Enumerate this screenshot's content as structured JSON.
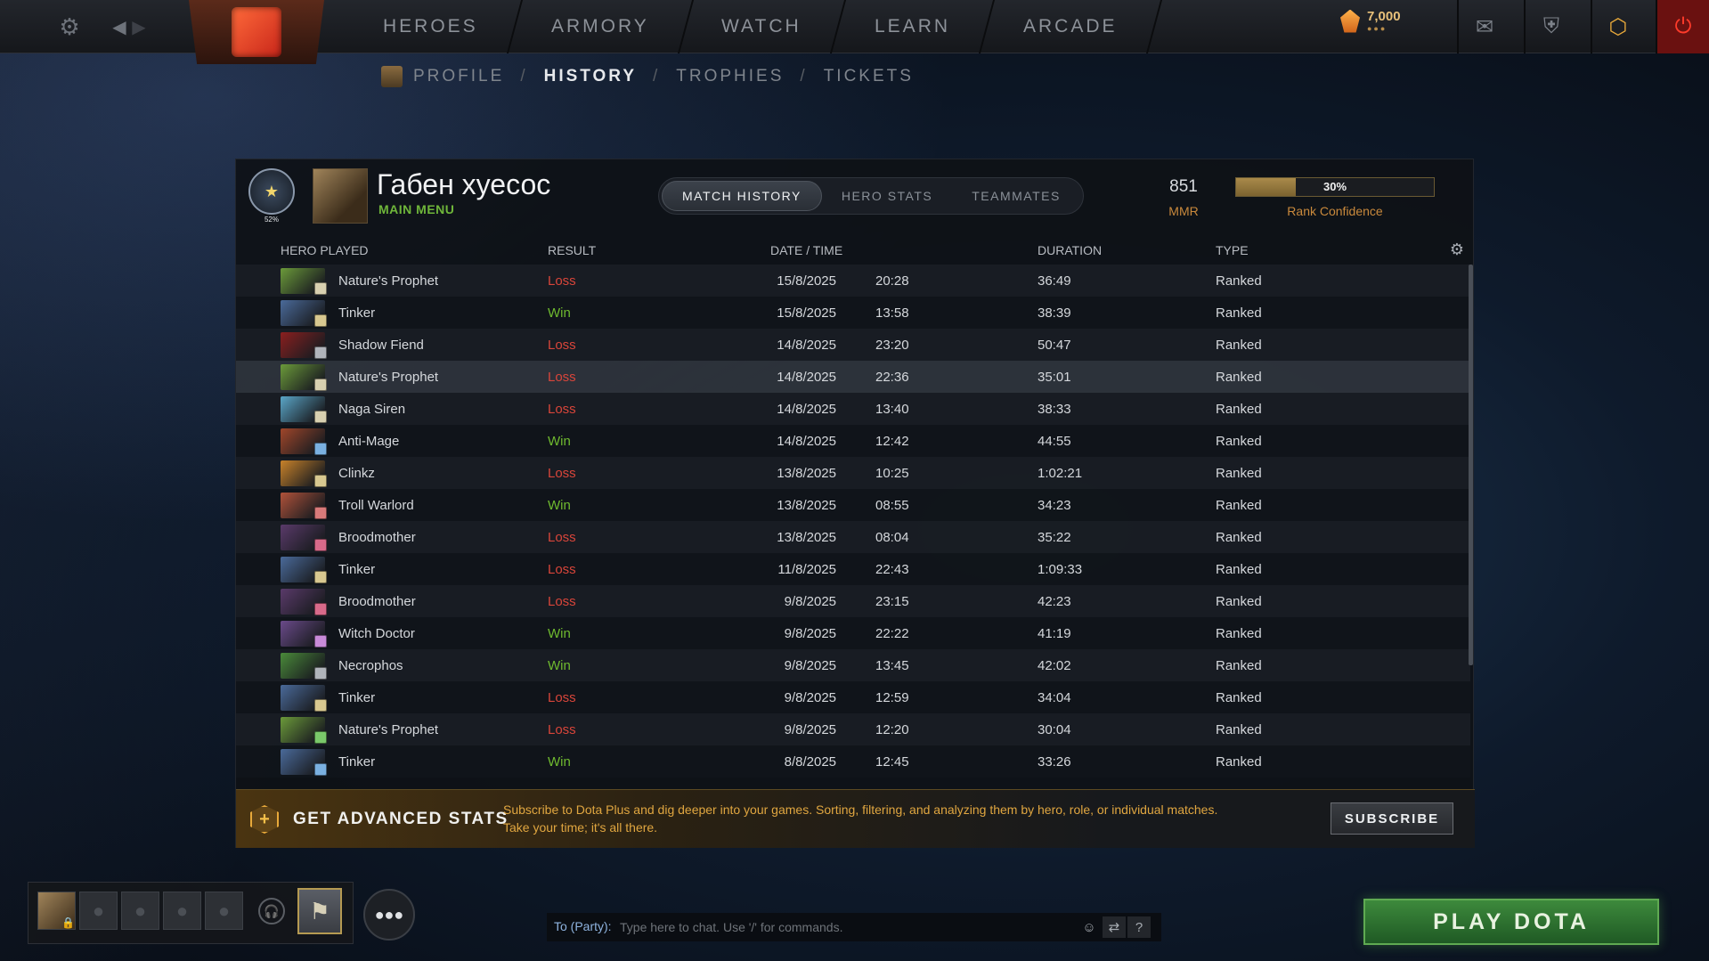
{
  "topbar": {
    "nav": [
      "HEROES",
      "ARMORY",
      "WATCH",
      "LEARN",
      "ARCADE"
    ],
    "shards": "7,000",
    "shard_dots": "●●●"
  },
  "subnav": {
    "items": [
      "PROFILE",
      "HISTORY",
      "TROPHIES",
      "TICKETS"
    ],
    "separator": "/"
  },
  "header": {
    "medal_pct": "52%",
    "player_name": "Габен хуесос",
    "player_status": "MAIN MENU",
    "tabs": [
      "MATCH HISTORY",
      "HERO STATS",
      "TEAMMATES"
    ],
    "mmr_value": "851",
    "mmr_label": "MMR",
    "rank_confidence_value": 30,
    "rank_confidence_text": "30%",
    "rank_confidence_label": "Rank Confidence"
  },
  "table": {
    "columns": [
      "HERO PLAYED",
      "RESULT",
      "DATE / TIME",
      "DURATION",
      "TYPE"
    ],
    "rows": [
      {
        "hero": "Nature's Prophet",
        "result": "Loss",
        "date": "15/8/2025",
        "time": "20:28",
        "duration": "36:49",
        "type": "Ranked",
        "color": "#6b9a3a",
        "badge": "#d8d0b0"
      },
      {
        "hero": "Tinker",
        "result": "Win",
        "date": "15/8/2025",
        "time": "13:58",
        "duration": "38:39",
        "type": "Ranked",
        "color": "#4a6a9a",
        "badge": "#d8c890"
      },
      {
        "hero": "Shadow Fiend",
        "result": "Loss",
        "date": "14/8/2025",
        "time": "23:20",
        "duration": "50:47",
        "type": "Ranked",
        "color": "#8a1f1f",
        "badge": "#b0b4bb"
      },
      {
        "hero": "Nature's Prophet",
        "result": "Loss",
        "date": "14/8/2025",
        "time": "22:36",
        "duration": "35:01",
        "type": "Ranked",
        "color": "#6b9a3a",
        "badge": "#d8d0b0"
      },
      {
        "hero": "Naga Siren",
        "result": "Loss",
        "date": "14/8/2025",
        "time": "13:40",
        "duration": "38:33",
        "type": "Ranked",
        "color": "#5aa6c8",
        "badge": "#d8d0b0"
      },
      {
        "hero": "Anti-Mage",
        "result": "Win",
        "date": "14/8/2025",
        "time": "12:42",
        "duration": "44:55",
        "type": "Ranked",
        "color": "#a0462a",
        "badge": "#7ab0e0"
      },
      {
        "hero": "Clinkz",
        "result": "Loss",
        "date": "13/8/2025",
        "time": "10:25",
        "duration": "1:02:21",
        "type": "Ranked",
        "color": "#c8822a",
        "badge": "#d8c890"
      },
      {
        "hero": "Troll Warlord",
        "result": "Win",
        "date": "13/8/2025",
        "time": "08:55",
        "duration": "34:23",
        "type": "Ranked",
        "color": "#b0523a",
        "badge": "#d87a7a"
      },
      {
        "hero": "Broodmother",
        "result": "Loss",
        "date": "13/8/2025",
        "time": "08:04",
        "duration": "35:22",
        "type": "Ranked",
        "color": "#5a3a6a",
        "badge": "#d86a8a"
      },
      {
        "hero": "Tinker",
        "result": "Loss",
        "date": "11/8/2025",
        "time": "22:43",
        "duration": "1:09:33",
        "type": "Ranked",
        "color": "#4a6a9a",
        "badge": "#d8c890"
      },
      {
        "hero": "Broodmother",
        "result": "Loss",
        "date": "9/8/2025",
        "time": "23:15",
        "duration": "42:23",
        "type": "Ranked",
        "color": "#5a3a6a",
        "badge": "#d86a8a"
      },
      {
        "hero": "Witch Doctor",
        "result": "Win",
        "date": "9/8/2025",
        "time": "22:22",
        "duration": "41:19",
        "type": "Ranked",
        "color": "#6a4a8a",
        "badge": "#c88ad8"
      },
      {
        "hero": "Necrophos",
        "result": "Win",
        "date": "9/8/2025",
        "time": "13:45",
        "duration": "42:02",
        "type": "Ranked",
        "color": "#4a8a3a",
        "badge": "#b0b4bb"
      },
      {
        "hero": "Tinker",
        "result": "Loss",
        "date": "9/8/2025",
        "time": "12:59",
        "duration": "34:04",
        "type": "Ranked",
        "color": "#4a6a9a",
        "badge": "#d8c890"
      },
      {
        "hero": "Nature's Prophet",
        "result": "Loss",
        "date": "9/8/2025",
        "time": "12:20",
        "duration": "30:04",
        "type": "Ranked",
        "color": "#6b9a3a",
        "badge": "#7ac86a"
      },
      {
        "hero": "Tinker",
        "result": "Win",
        "date": "8/8/2025",
        "time": "12:45",
        "duration": "33:26",
        "type": "Ranked",
        "color": "#4a6a9a",
        "badge": "#7ab0e0"
      }
    ],
    "highlight_index": 3
  },
  "promo": {
    "title": "GET ADVANCED STATS",
    "text": "Subscribe to Dota Plus and dig deeper into your games. Sorting, filtering, and analyzing them by hero, role, or individual matches. Take your time; it's all there.",
    "button": "SUBSCRIBE"
  },
  "chat": {
    "prefix": "To (Party):",
    "placeholder": "Type here to chat. Use '/' for commands."
  },
  "play_button": "PLAY DOTA",
  "colors": {
    "loss": "#d8453a",
    "win": "#6fba2f",
    "accent_gold": "#c9893c",
    "status_green": "#6fb63a",
    "play_green": "#3d8a3c"
  }
}
